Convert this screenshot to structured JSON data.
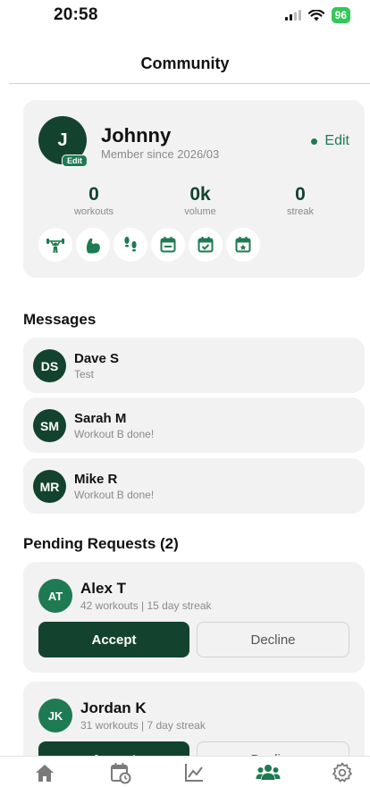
{
  "status_bar": {
    "time": "20:58",
    "battery": "96"
  },
  "header": {
    "title": "Community"
  },
  "profile": {
    "initial": "J",
    "avatar_edit_label": "Edit",
    "name": "Johnny",
    "member_since": "Member since 2026/03",
    "edit_label": "Edit",
    "stats": [
      {
        "value": "0",
        "label": "workouts"
      },
      {
        "value": "0k",
        "label": "volume"
      },
      {
        "value": "0",
        "label": "streak"
      }
    ],
    "badges": [
      "barbell-icon",
      "flexed-biceps-icon",
      "footprints-icon",
      "calendar-icon",
      "calendar-check-icon",
      "calendar-star-icon"
    ]
  },
  "messages": {
    "title": "Messages",
    "items": [
      {
        "initials": "DS",
        "name": "Dave S",
        "preview": "Test"
      },
      {
        "initials": "SM",
        "name": "Sarah M",
        "preview": "Workout B done!"
      },
      {
        "initials": "MR",
        "name": "Mike R",
        "preview": "Workout B done!"
      }
    ]
  },
  "requests": {
    "title": "Pending Requests (2)",
    "accept_label": "Accept",
    "decline_label": "Decline",
    "items": [
      {
        "initials": "AT",
        "name": "Alex T",
        "meta": "42 workouts | 15 day streak"
      },
      {
        "initials": "JK",
        "name": "Jordan K",
        "meta": "31 workouts | 7 day streak"
      }
    ]
  },
  "tab_bar": {
    "tabs": [
      "home-icon",
      "calendar-clock-icon",
      "chart-icon",
      "community-icon",
      "settings-icon"
    ],
    "active": "community-icon",
    "colors": {
      "active": "#1e7a52",
      "inactive": "#7a7a7a"
    }
  },
  "colors": {
    "primary_dark": "#13432e",
    "primary": "#1e7a52",
    "card_bg": "#f2f2f3"
  }
}
